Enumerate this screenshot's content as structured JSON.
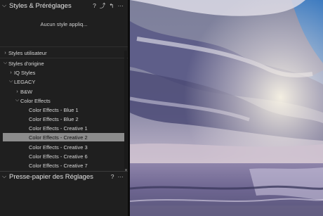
{
  "styles_panel": {
    "title": "Styles & Préréglages",
    "tools": {
      "help": "?",
      "edit": "⤴",
      "apply": "↰",
      "more": "···"
    },
    "empty_note": "Aucun style appliq..."
  },
  "tree": {
    "user_styles": "Styles utilisateur",
    "builtin_styles": "Styles d'origine",
    "iq_styles": "IQ Styles",
    "legacy": "LEGACY",
    "bw": "B&W",
    "color_effects": "Color Effects",
    "items": [
      {
        "label": "Color Effects - Blue 1",
        "selected": false
      },
      {
        "label": "Color Effects - Blue 2",
        "selected": false
      },
      {
        "label": "Color Effects - Creative 1",
        "selected": false
      },
      {
        "label": "Color Effects - Creative 2",
        "selected": true
      },
      {
        "label": "Color Effects - Creative 3",
        "selected": false
      },
      {
        "label": "Color Effects - Creative 6",
        "selected": false
      },
      {
        "label": "Color Effects - Creative 7",
        "selected": false
      }
    ]
  },
  "clipboard_panel": {
    "title": "Presse-papier des Réglages",
    "tools": {
      "help": "?",
      "more": "···"
    }
  },
  "colors": {
    "selected_row": "#8c8c8c",
    "panel_bg": "#1f1f1f"
  }
}
